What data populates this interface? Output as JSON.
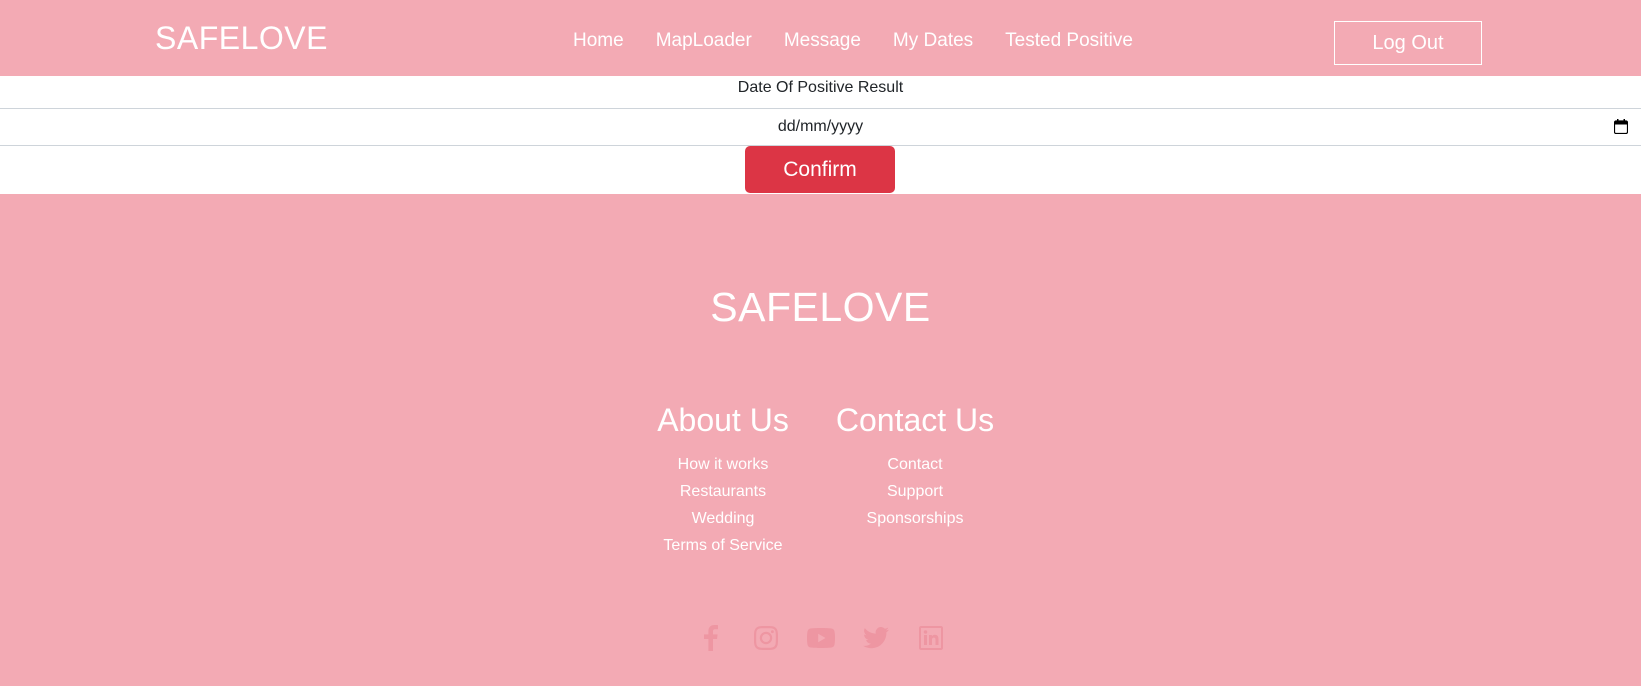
{
  "navbar": {
    "brand": "SAFELOVE",
    "links": [
      "Home",
      "MapLoader",
      "Message",
      "My Dates",
      "Tested Positive"
    ],
    "logout_label": "Log Out"
  },
  "form": {
    "label": "Date Of Positive Result",
    "date_placeholder": "dd/mm/yyyy",
    "confirm_label": "Confirm"
  },
  "footer": {
    "brand": "SAFELOVE",
    "about": {
      "heading": "About Us",
      "links": [
        "How it works",
        "Restaurants",
        "Wedding",
        "Terms of Service"
      ]
    },
    "contact": {
      "heading": "Contact Us",
      "links": [
        "Contact",
        "Support",
        "Sponsorships"
      ]
    },
    "social_icons": [
      "facebook-icon",
      "instagram-icon",
      "youtube-icon",
      "twitter-icon",
      "linkedin-icon"
    ]
  },
  "colors": {
    "primary_pink": "#f3aab4",
    "confirm_red": "#dc3545",
    "social_icon": "#ee96a2",
    "white": "#ffffff"
  }
}
